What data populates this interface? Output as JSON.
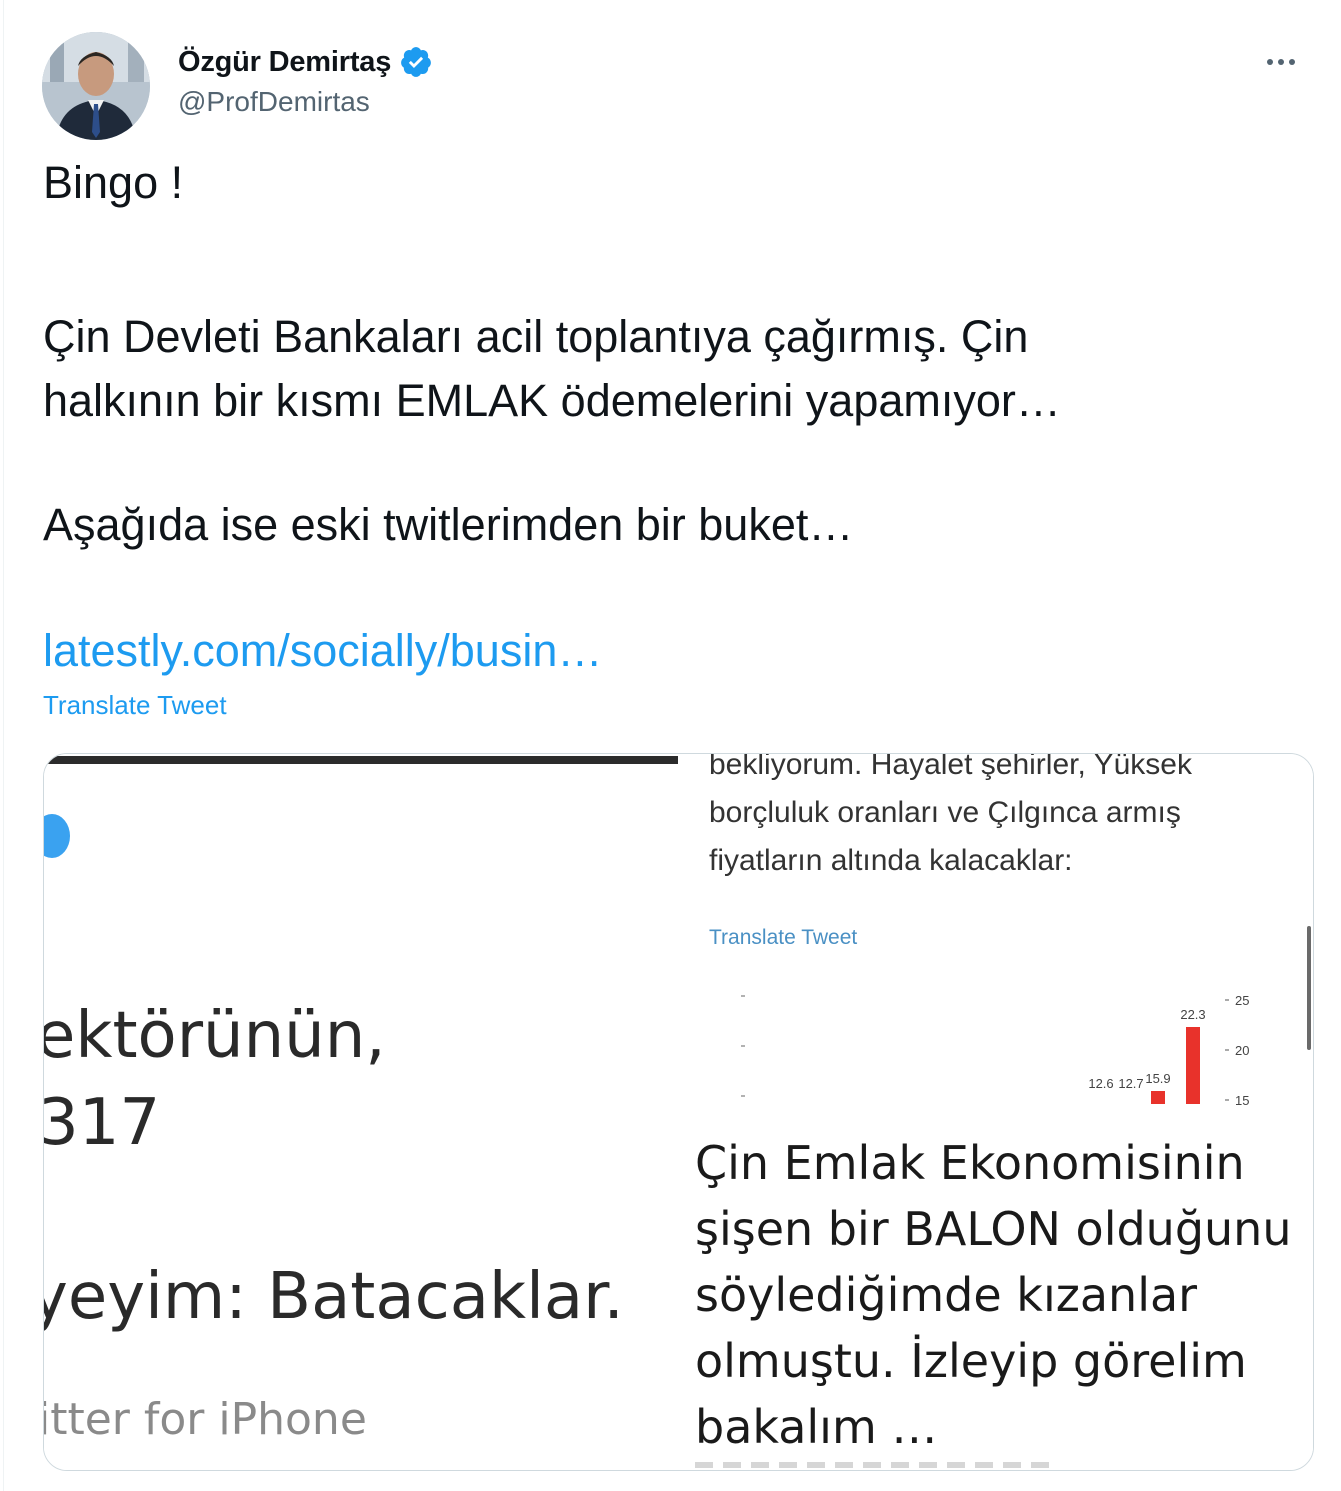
{
  "author": {
    "name": "Özgür Demirtaş",
    "handle": "@ProfDemirtas",
    "verified_icon": "verified-badge-icon"
  },
  "more_icon": "more-horizontal-icon",
  "tweet": {
    "lines": [
      "Bingo !",
      "Çin Devleti Bankaları acil toplantıya çağırmış. Çin",
      "halkının bir kısmı EMLAK ödemelerini yapamıyor…",
      "Aşağıda ise eski twitlerimden bir buket…"
    ],
    "link": "latestly.com/socially/busin…",
    "translate_label": "Translate Tweet"
  },
  "media": {
    "left_image": {
      "lines": [
        "ektörünün,",
        "317",
        "yeyim: Batacaklar.",
        "itter for iPhone"
      ]
    },
    "right_image": {
      "top_lines": [
        "bekliyorum. Hayalet şehirler, Yüksek",
        "borçluluk oranları ve Çılgınca armış",
        "fiyatların altında kalacaklar:"
      ],
      "translate_label": "Translate Tweet",
      "bottom_lines": [
        "Çin Emlak Ekonomisinin",
        "şişen bir BALON olduğunu",
        "söylediğimde kızanlar",
        "olmuştu. İzleyip görelim",
        "bakalım …"
      ]
    }
  },
  "chart_data": {
    "type": "bar",
    "categories": [
      "",
      "",
      "",
      ""
    ],
    "values": [
      12.6,
      12.7,
      15.9,
      22.3
    ],
    "value_labels": [
      "12.6",
      "12.7",
      "15.9",
      "22.3"
    ],
    "ytick_labels": [
      "25",
      "20",
      "15"
    ],
    "ylim": [
      15,
      25
    ],
    "bar_color": "#e8322b",
    "title": "",
    "xlabel": "",
    "ylabel": ""
  }
}
